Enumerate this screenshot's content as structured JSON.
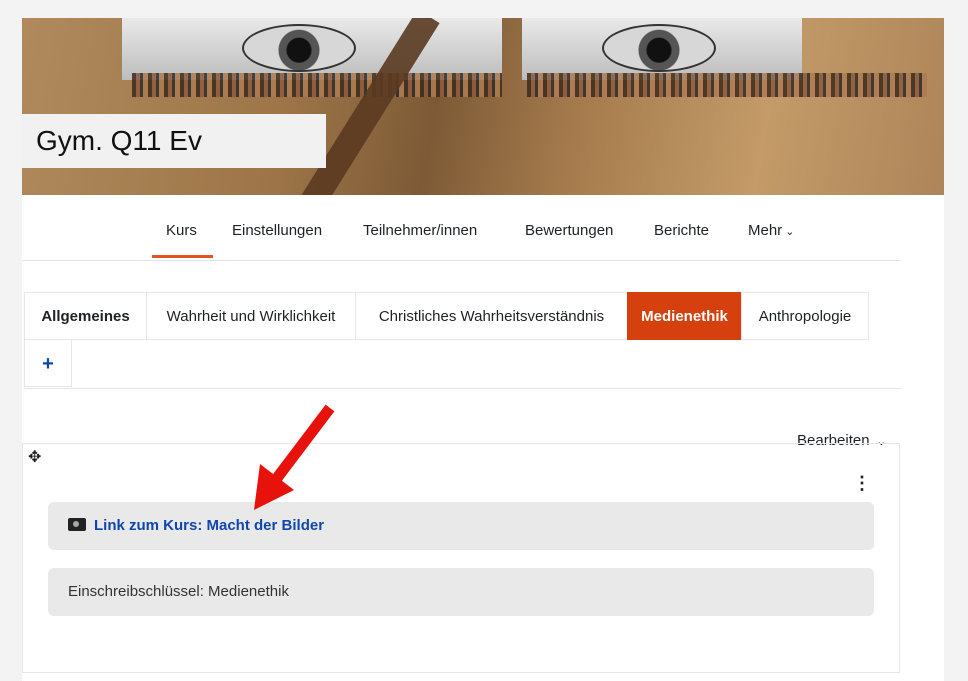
{
  "banner": {
    "course_title": "Gym. Q11 Ev"
  },
  "nav": {
    "items": [
      {
        "label": "Kurs"
      },
      {
        "label": "Einstellungen"
      },
      {
        "label": "Teilnehmer/innen"
      },
      {
        "label": "Bewertungen"
      },
      {
        "label": "Berichte"
      },
      {
        "label": "Mehr"
      }
    ]
  },
  "tabs": [
    {
      "label": "Allgemeines"
    },
    {
      "label": "Wahrheit und Wirklichkeit"
    },
    {
      "label": "Christliches Wahrheitsverständnis"
    },
    {
      "label": "Medienethik"
    },
    {
      "label": "Anthropologie"
    },
    {
      "label": "+"
    }
  ],
  "edit_menu": {
    "label": "Bearbeiten"
  },
  "content": {
    "link_label": "Link zum Kurs: Macht der Bilder",
    "enrol_key_text": "Einschreibschlüssel: Medienethik"
  },
  "icons": [
    "move-icon",
    "camera-icon",
    "kebab-menu-icon",
    "chevron-down-icon"
  ],
  "colors": {
    "accent": "#d6400e",
    "link": "#0f47ad",
    "arrow": "#e8120c"
  }
}
